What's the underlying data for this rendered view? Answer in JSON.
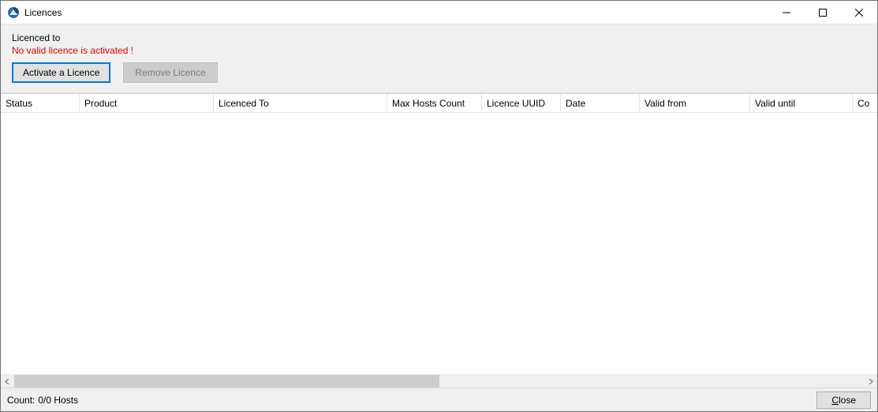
{
  "window": {
    "title": "Licences"
  },
  "header": {
    "licenced_to_label": "Licenced to",
    "warning_text": "No valid licence is activated !",
    "activate_label": "Activate a Licence",
    "remove_label": "Remove Licence"
  },
  "table": {
    "columns": {
      "status": "Status",
      "product": "Product",
      "licenced_to": "Licenced To",
      "max_hosts": "Max Hosts Count",
      "licence_uuid": "Licence UUID",
      "date": "Date",
      "valid_from": "Valid from",
      "valid_until": "Valid until",
      "co": "Co"
    },
    "rows": []
  },
  "footer": {
    "count_label": "Count:",
    "count_value": "0/0 Hosts",
    "close_label_u": "C",
    "close_label_rest": "lose"
  },
  "colors": {
    "warning": "#e30000",
    "focus_border": "#0078d7"
  }
}
